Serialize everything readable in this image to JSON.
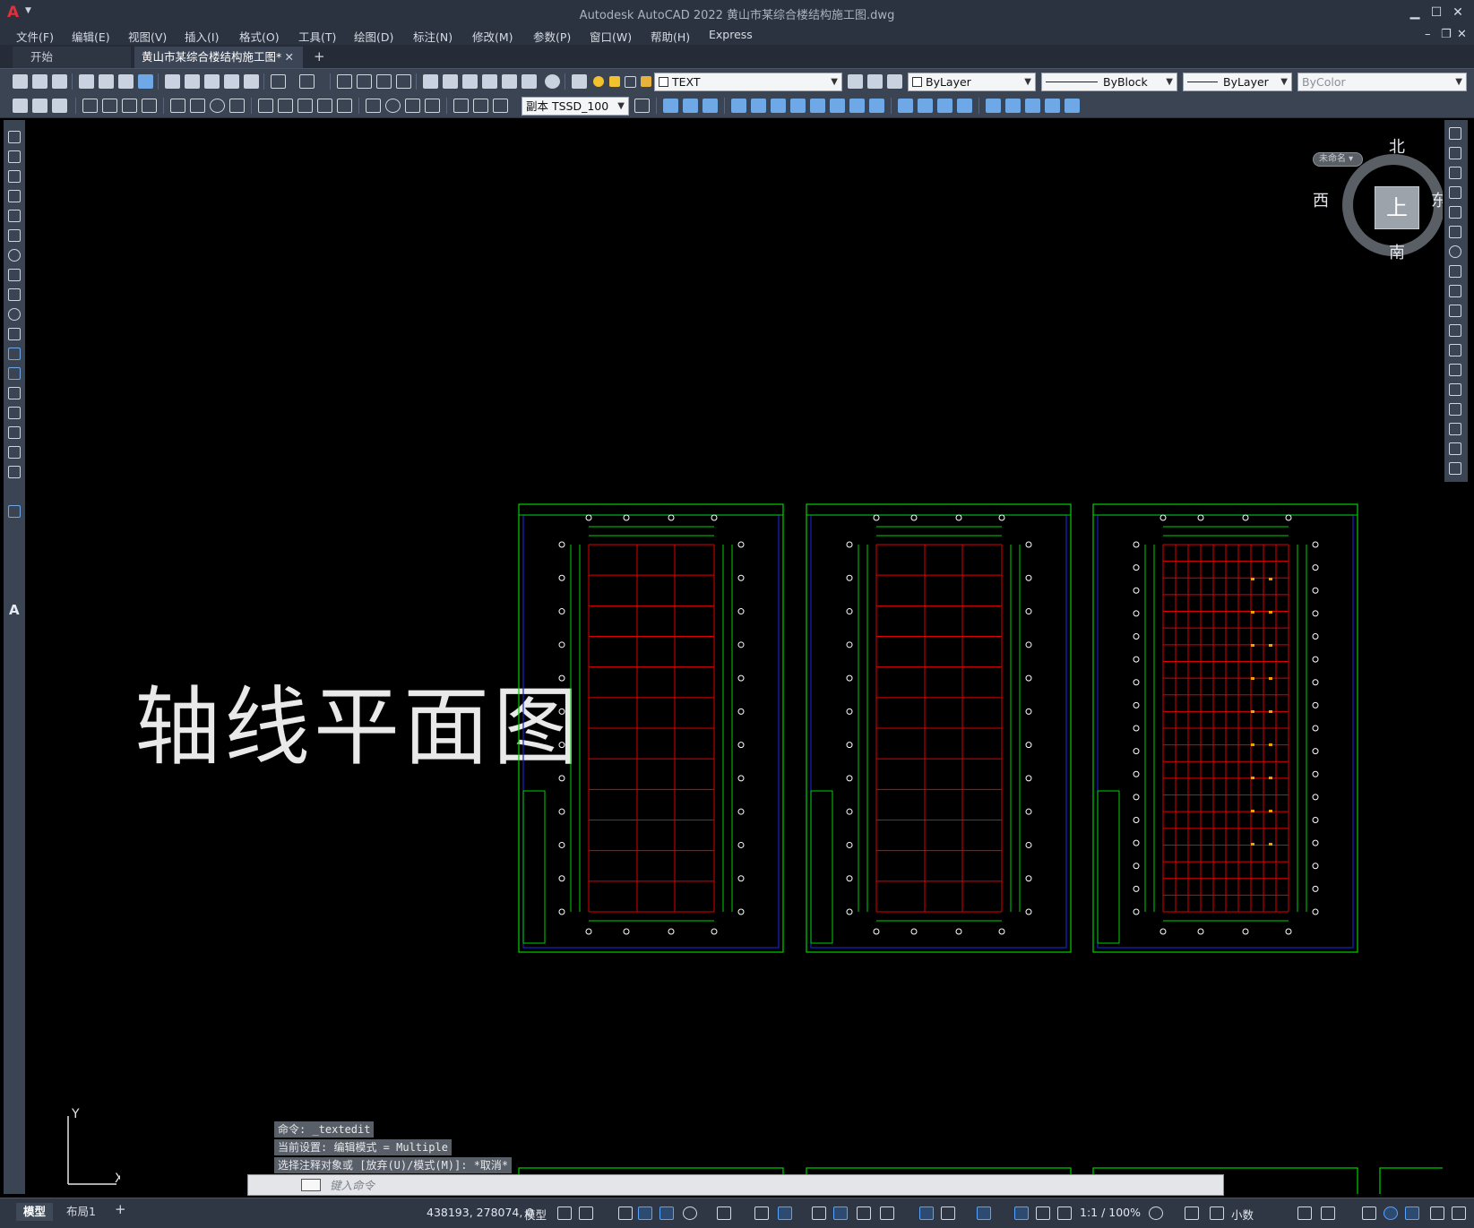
{
  "window": {
    "title": "Autodesk AutoCAD 2022    黄山市某综合楼结构施工图.dwg",
    "app_icon": "A"
  },
  "menu": [
    "文件(F)",
    "编辑(E)",
    "视图(V)",
    "插入(I)",
    "格式(O)",
    "工具(T)",
    "绘图(D)",
    "标注(N)",
    "修改(M)",
    "参数(P)",
    "窗口(W)",
    "帮助(H)",
    "Express"
  ],
  "tabs": {
    "start": "开始",
    "file": "黄山市某综合楼结构施工图*"
  },
  "toolbar": {
    "layer_combo": "TEXT",
    "color_combo": "ByLayer",
    "linetype_combo": "ByBlock",
    "lineweight_combo": "ByLayer",
    "plotstyle_combo": "ByColor",
    "dimstyle_combo": "副本 TSSD_100"
  },
  "drawing": {
    "title_text": "轴线平面图",
    "colors": {
      "frame": "#00d000",
      "grid": "#e00000",
      "border": "#1a22c8",
      "bubble": "#ffffff",
      "accent": "#f0a000"
    }
  },
  "viewcube": {
    "north": "北",
    "south": "南",
    "east": "东",
    "west": "西",
    "top_face": "上",
    "wcs": "未命名"
  },
  "ucs": {
    "x": "X",
    "y": "Y"
  },
  "command": {
    "history": [
      "命令: _textedit",
      "当前设置: 编辑模式 = Multiple",
      "选择注释对象或 [放弃(U)/模式(M)]: *取消*"
    ],
    "placeholder": "键入命令"
  },
  "status": {
    "layout_tabs": [
      "模型",
      "布局1"
    ],
    "coords": "438193, 278074, 0",
    "model": "模型",
    "scale": "1:1 / 100%",
    "units": "小数"
  }
}
